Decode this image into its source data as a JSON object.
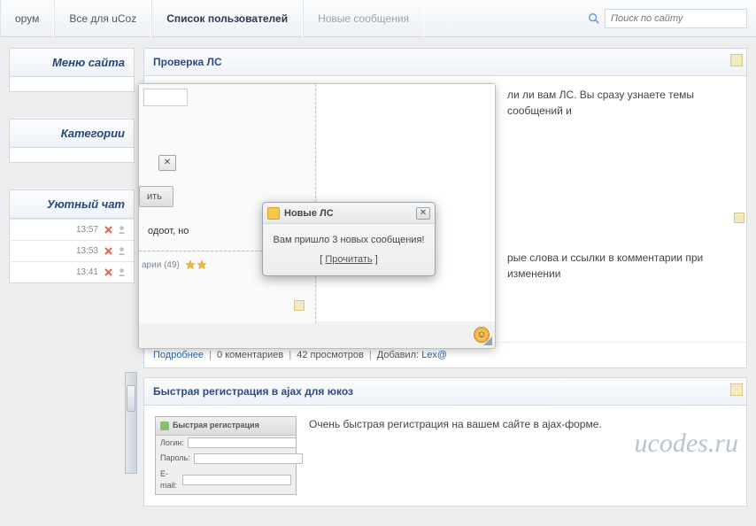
{
  "nav": {
    "forum": "орум",
    "ucoz": "Все для uCoz",
    "users": "Список пользователей",
    "newmsg": "Новые сообщения"
  },
  "search": {
    "placeholder": "Поиск по сайту"
  },
  "sidebar": {
    "menu_title": "Меню сайта",
    "categories_title": "Категории",
    "chat_title": "Уютный чат",
    "chat": [
      {
        "time": "13:57"
      },
      {
        "time": "13:53"
      },
      {
        "time": "13:41"
      }
    ]
  },
  "post1": {
    "title": "Проверка ЛС",
    "text_right": "ли ли вам ЛС. Вы сразу узнаете темы сообщений и",
    "text_right2": "рые слова и ссылки в комментарии при изменении",
    "footer": {
      "more": "Подробнее",
      "comments": "0 коментариев",
      "views": "42 просмотров",
      "added": "Добавил:",
      "author": "Lex@"
    }
  },
  "overlay": {
    "btn": "ить",
    "trunc": "одоот, но",
    "meta": "арии (49)"
  },
  "modal": {
    "title": "Новые ЛС",
    "body": "Вам пришло 3 новых сообщения!",
    "read": "Прочитать"
  },
  "post2": {
    "title": "Быстрая регистрация в ajax для юкоз",
    "text": "Очень быстрая регистрация на вашем сайте в ajax-форме.",
    "form": {
      "title": "Быстрая регистрация",
      "login": "Логин:",
      "password": "Пароль:",
      "email": "E-mail:"
    }
  },
  "watermark": "ucodes.ru"
}
